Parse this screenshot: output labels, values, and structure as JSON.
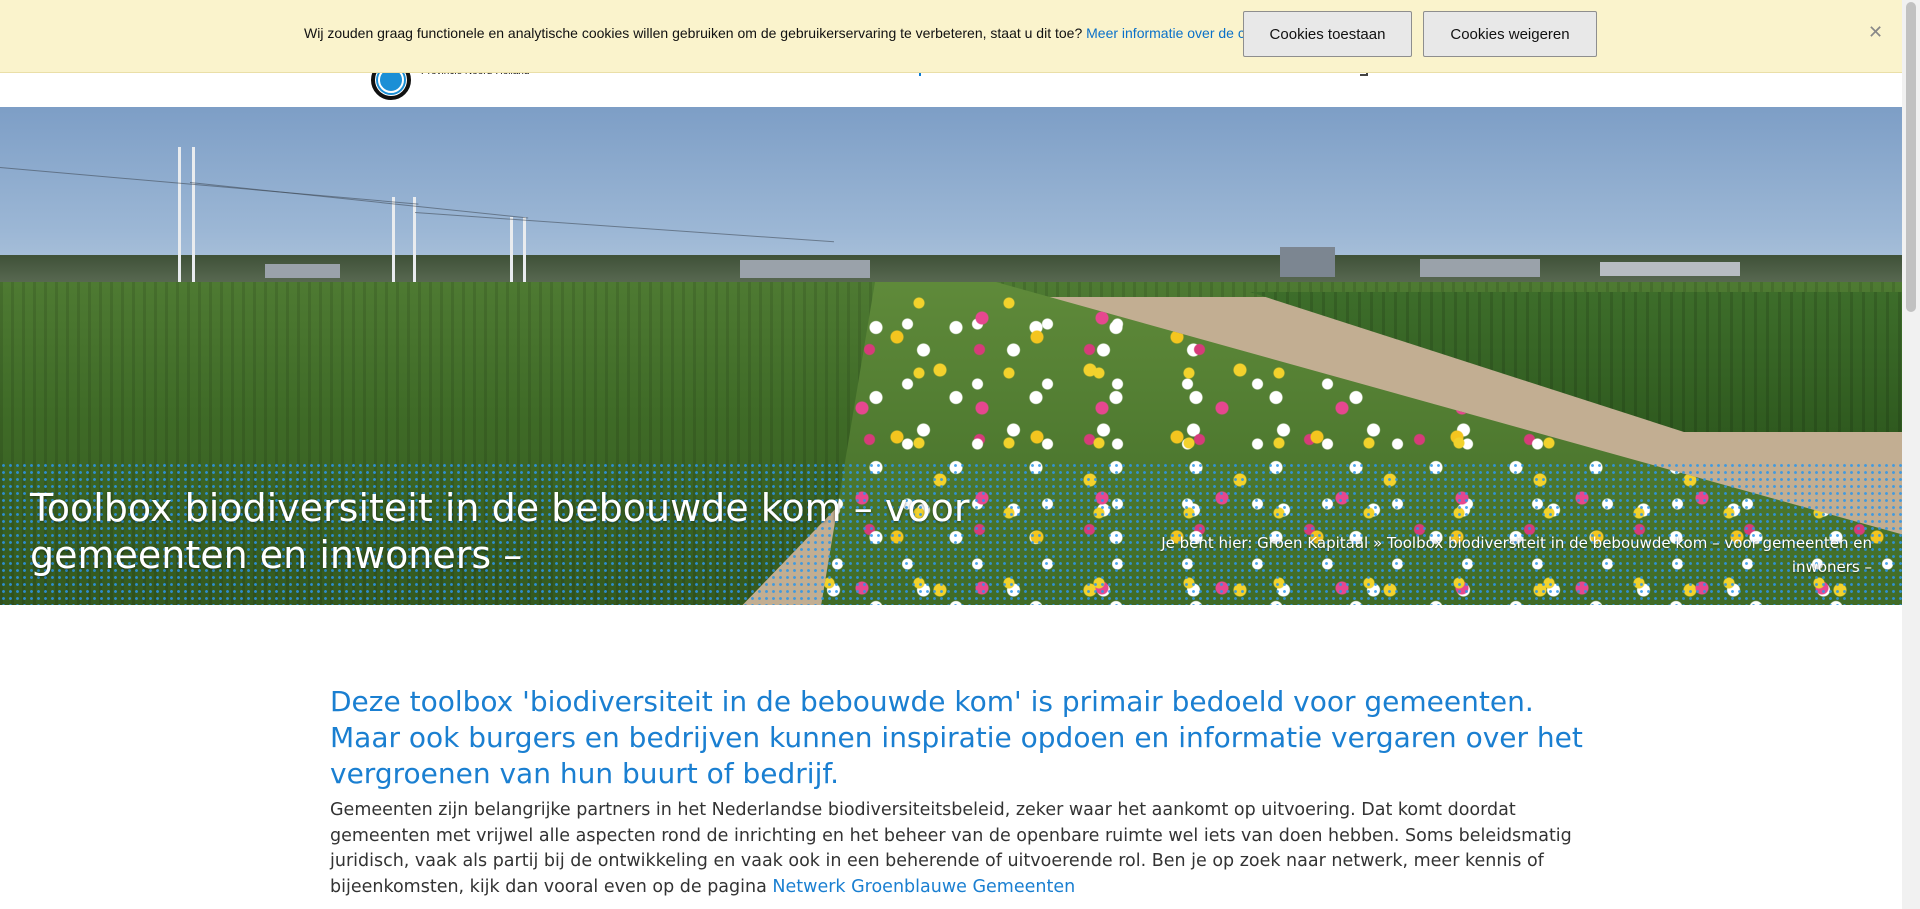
{
  "header": {
    "logo_text": "Provincie Noord-Holland"
  },
  "cookie_bar": {
    "message": "Wij zouden graag functionele en analytische cookies willen gebruiken om de gebruikerservaring te verbeteren, staat u dit toe?",
    "more_info_link": "Meer informatie over de cookiewet.",
    "allow_label": "Cookies toestaan",
    "deny_label": "Cookies weigeren",
    "close_icon": "close-icon"
  },
  "hero": {
    "title": "Toolbox biodiversiteit in de bebouwde kom – voor gemeenten en inwoners –",
    "breadcrumb_prefix": "Je bent hier:",
    "breadcrumb_home": "Groen Kapitaal",
    "breadcrumb_separator": "»",
    "breadcrumb_current": "Toolbox biodiversiteit in de bebouwde kom – voor gemeenten en inwoners –"
  },
  "content": {
    "lead": "Deze toolbox 'biodiversiteit in de bebouwde kom' is primair bedoeld voor gemeenten. Maar ook burgers en bedrijven kunnen inspiratie opdoen en informatie vergaren over het vergroenen van hun buurt of bedrijf.",
    "body": "Gemeenten zijn belangrijke partners in het Nederlandse biodiversiteitsbeleid, zeker waar het aankomt op uitvoering. Dat komt doordat gemeenten met vrijwel alle aspecten rond de inrichting en het beheer van de openbare ruimte wel iets van doen hebben. Soms beleidsmatig juridisch, vaak als partij bij de ontwikkeling en vaak ook in een beherende of uitvoerende rol. Ben je op zoek naar netwerk, meer kennis of bijeenkomsten, kijk dan vooral even op de pagina",
    "body_link": "Netwerk Groenblauwe Gemeenten"
  },
  "colors": {
    "accent_blue": "#1a7fd1",
    "cookie_bar_bg": "#faf3cc",
    "dot_overlay": "#2c96eb"
  }
}
